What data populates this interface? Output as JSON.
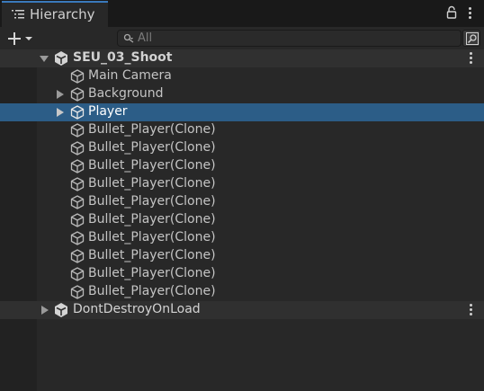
{
  "window": {
    "tab_title": "Hierarchy",
    "tab_icon": "hierarchy-list-icon",
    "lock_icon": "lock-icon",
    "menu_icon": "kebab-menu-icon"
  },
  "toolbar": {
    "add_icon": "plus-icon",
    "dropdown_icon": "caret-down-icon",
    "search_placeholder": "All",
    "search_value": "",
    "filter_icon": "search-filter-icon"
  },
  "colors": {
    "selection": "#2c5d87",
    "tab_accent": "#3a79bb",
    "panel_bg": "#282828"
  },
  "tree": {
    "scene": {
      "label": "SEU_03_Shoot",
      "expanded": true,
      "children": [
        {
          "label": "Main Camera",
          "expandable": false,
          "selected": false
        },
        {
          "label": "Background",
          "expandable": true,
          "selected": false
        },
        {
          "label": "Player",
          "expandable": true,
          "selected": true
        },
        {
          "label": "Bullet_Player(Clone)",
          "expandable": false,
          "selected": false
        },
        {
          "label": "Bullet_Player(Clone)",
          "expandable": false,
          "selected": false
        },
        {
          "label": "Bullet_Player(Clone)",
          "expandable": false,
          "selected": false
        },
        {
          "label": "Bullet_Player(Clone)",
          "expandable": false,
          "selected": false
        },
        {
          "label": "Bullet_Player(Clone)",
          "expandable": false,
          "selected": false
        },
        {
          "label": "Bullet_Player(Clone)",
          "expandable": false,
          "selected": false
        },
        {
          "label": "Bullet_Player(Clone)",
          "expandable": false,
          "selected": false
        },
        {
          "label": "Bullet_Player(Clone)",
          "expandable": false,
          "selected": false
        },
        {
          "label": "Bullet_Player(Clone)",
          "expandable": false,
          "selected": false
        },
        {
          "label": "Bullet_Player(Clone)",
          "expandable": false,
          "selected": false
        }
      ]
    },
    "dont_destroy": {
      "label": "DontDestroyOnLoad",
      "expanded": false
    }
  }
}
